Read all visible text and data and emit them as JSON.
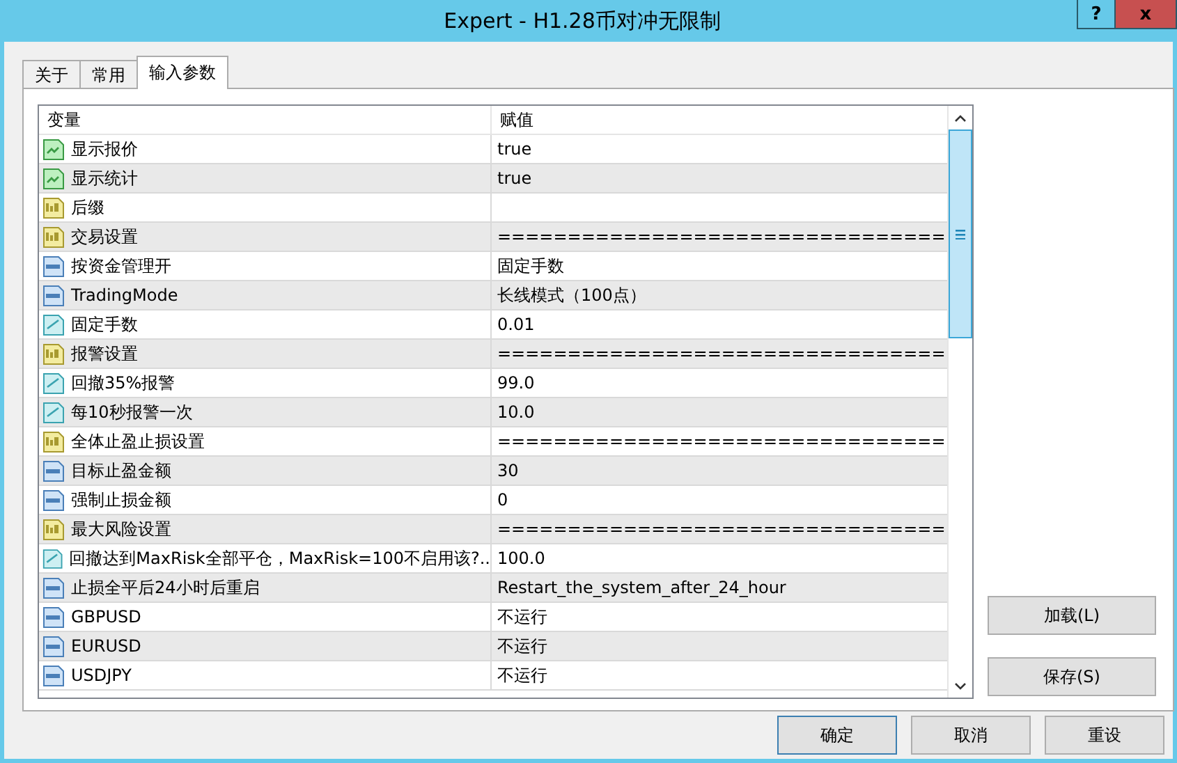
{
  "window": {
    "title": "Expert - H1.28币对冲无限制",
    "help": "?",
    "close": "x"
  },
  "tabs": [
    {
      "label": "关于",
      "selected": false
    },
    {
      "label": "常用",
      "selected": false
    },
    {
      "label": "输入参数",
      "selected": true
    }
  ],
  "table": {
    "columns": [
      "变量",
      "赋值"
    ],
    "rows": [
      {
        "kind": "bool",
        "name": "显示报价",
        "value": "true"
      },
      {
        "kind": "bool",
        "name": "显示统计",
        "value": "true"
      },
      {
        "kind": "string",
        "name": "后缀"
      },
      {
        "kind": "string",
        "name": "交易设置",
        "value": "================================"
      },
      {
        "kind": "int",
        "name": "按资金管理开",
        "value": "固定手数"
      },
      {
        "kind": "int",
        "name": "TradingMode",
        "value": "长线模式（100点）"
      },
      {
        "kind": "double",
        "name": "固定手数",
        "value": "0.01"
      },
      {
        "kind": "string",
        "name": "报警设置",
        "value": "================================"
      },
      {
        "kind": "double",
        "name": "回撤35%报警",
        "value": "99.0"
      },
      {
        "kind": "double",
        "name": "每10秒报警一次",
        "value": "10.0"
      },
      {
        "kind": "string",
        "name": "全体止盈止损设置",
        "value": "================================"
      },
      {
        "kind": "int",
        "name": "目标止盈金额",
        "value": "30"
      },
      {
        "kind": "int",
        "name": "强制止损金额",
        "value": "0"
      },
      {
        "kind": "string",
        "name": "最大风险设置",
        "value": "================================"
      },
      {
        "kind": "double",
        "name": "回撤达到MaxRisk全部平仓，MaxRisk=100不启用该?..",
        "value": "100.0"
      },
      {
        "kind": "int",
        "name": "止损全平后24小时后重启",
        "value": "Restart_the_system_after_24_hour"
      },
      {
        "kind": "int",
        "name": "GBPUSD",
        "value": "不运行"
      },
      {
        "kind": "int",
        "name": "EURUSD",
        "value": "不运行"
      },
      {
        "kind": "int",
        "name": "USDJPY",
        "value": "不运行"
      }
    ]
  },
  "side_buttons": [
    "加载(L)",
    "保存(S)"
  ],
  "buttons": [
    {
      "label": "确定",
      "selected": true
    },
    {
      "label": "取消",
      "selected": false
    },
    {
      "label": "重设",
      "selected": false
    }
  ]
}
